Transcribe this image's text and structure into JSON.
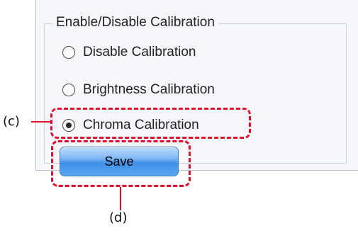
{
  "group": {
    "title": "Enable/Disable Calibration",
    "options": [
      {
        "label": "Disable Calibration",
        "checked": false
      },
      {
        "label": "Brightness Calibration",
        "checked": false
      },
      {
        "label": "Chroma Calibration",
        "checked": true
      }
    ]
  },
  "save_label": "Save",
  "callouts": {
    "c": "(c)",
    "d": "(d)"
  },
  "colors": {
    "callout": "#e0102c",
    "button_blue": "#3f8ee8"
  }
}
